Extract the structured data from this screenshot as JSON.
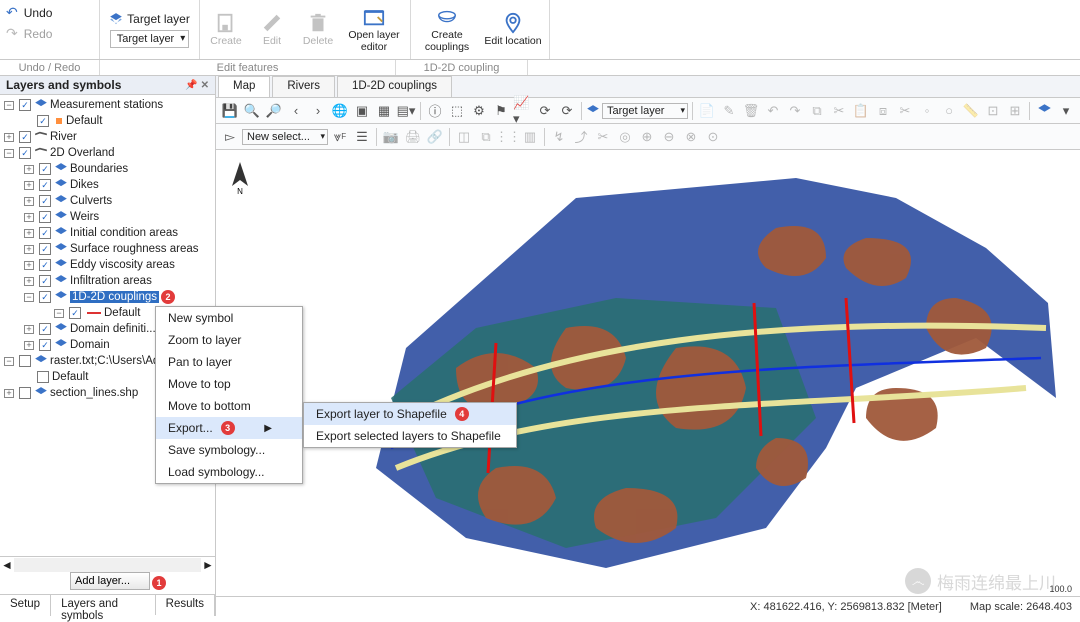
{
  "ribbon": {
    "undo": "Undo",
    "redo": "Redo",
    "target_layer_caption": "Target layer",
    "target_layer_value": "Target layer",
    "create": "Create",
    "edit": "Edit",
    "delete": "Delete",
    "open_layer_editor": "Open layer\neditor",
    "create_couplings": "Create\ncouplings",
    "edit_location": "Edit location"
  },
  "ribbon_captions": {
    "undo_redo": "Undo / Redo",
    "edit_features": "Edit features",
    "coupling": "1D-2D coupling"
  },
  "sidebar": {
    "title": "Layers and symbols",
    "add_layer": "Add layer...",
    "tabs": {
      "setup": "Setup",
      "layers": "Layers and symbols",
      "results": "Results"
    }
  },
  "tree": {
    "measurement": "Measurement stations",
    "default": "Default",
    "river": "River",
    "overland": "2D Overland",
    "boundaries": "Boundaries",
    "dikes": "Dikes",
    "culverts": "Culverts",
    "weirs": "Weirs",
    "initial": "Initial condition areas",
    "roughness": "Surface roughness areas",
    "eddy": "Eddy viscosity areas",
    "infiltration": "Infiltration areas",
    "couplings": "1D-2D couplings",
    "domain_def": "Domain definiti...",
    "domain": "Domain",
    "raster": "raster.txt;C:\\Users\\Ad...",
    "section": "section_lines.shp"
  },
  "badges": {
    "couplings": "2",
    "export": "3",
    "shapefile": "4",
    "addlayer": "1"
  },
  "ctx1": {
    "new_symbol": "New symbol",
    "zoom": "Zoom to layer",
    "pan": "Pan to layer",
    "top": "Move to top",
    "bottom": "Move to bottom",
    "export": "Export...",
    "save_sym": "Save symbology...",
    "load_sym": "Load symbology..."
  },
  "ctx2": {
    "shapefile": "Export layer to Shapefile",
    "sel_shapefile": "Export selected layers to Shapefile"
  },
  "map": {
    "tabs": {
      "map": "Map",
      "rivers": "Rivers",
      "coup": "1D-2D couplings"
    },
    "target_layer": "Target layer",
    "newselect": "New select..."
  },
  "status": {
    "coord": "X: 481622.416, Y: 2569813.832 [Meter]",
    "scale": "Map scale: 2648.403"
  },
  "watermark": "梅雨连绵最上川",
  "scale_label": "100.0"
}
